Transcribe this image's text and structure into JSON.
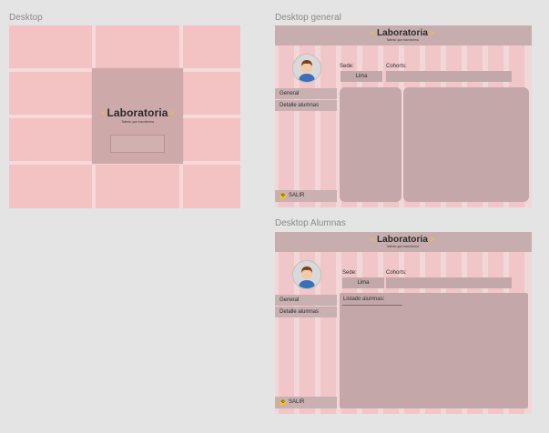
{
  "frames": {
    "desktop": {
      "title": "Desktop"
    },
    "general": {
      "title": "Desktop general"
    },
    "alumnas": {
      "title": "Desktop Alumnas"
    }
  },
  "logo": {
    "word": "Laboratoria",
    "tagline": "Talento que transforma",
    "bracket_left": "<",
    "bracket_right": ">",
    "accent": "#f0c12e"
  },
  "general": {
    "sede_label": "Sede:",
    "sede_value": "Lima",
    "cohorts_label": "Cohorts:",
    "menu": [
      "General",
      "Detalle alumnas"
    ],
    "salir": "SALIR"
  },
  "alumnas": {
    "sede_label": "Sede:",
    "sede_value": "Lima",
    "cohorts_label": "Cohorts:",
    "menu": [
      "General",
      "Detalle alumnas"
    ],
    "list_label": "Listado alumnas:",
    "salir": "SALIR"
  },
  "colors": {
    "background": "#e4e4e4",
    "grid_pink": "#f3c2c2",
    "overlay": "#c8adae"
  }
}
